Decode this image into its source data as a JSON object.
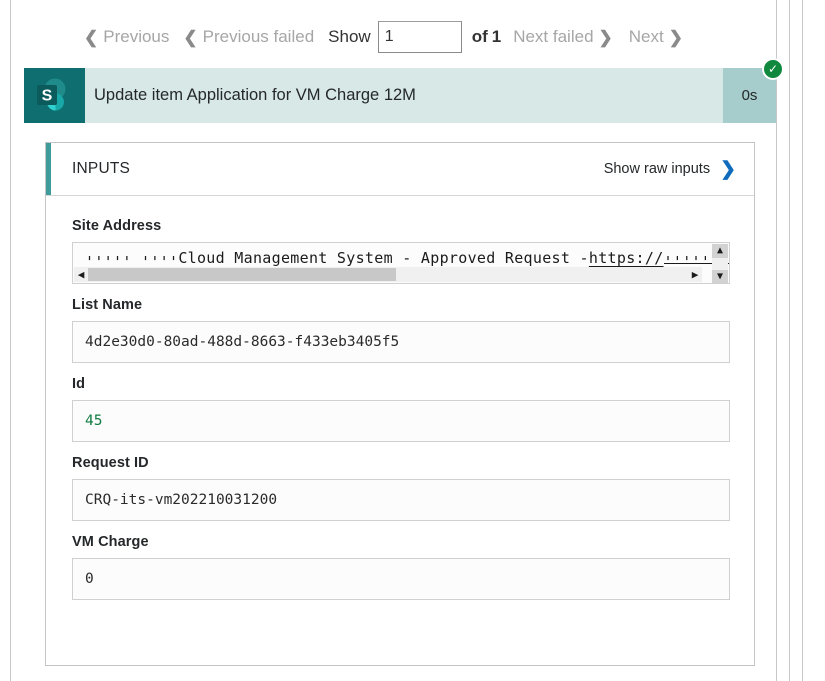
{
  "nav": {
    "previous_label": "Previous",
    "previous_failed_label": "Previous failed",
    "show_label": "Show",
    "page_value": "1",
    "of_label": "of",
    "page_count": "1",
    "next_failed_label": "Next failed",
    "next_label": "Next",
    "chevron_left": "❮",
    "chevron_right": "❯"
  },
  "action": {
    "icon_name": "sharepoint-icon",
    "title": "Update item Application for VM Charge 12M",
    "duration": "0s",
    "status_glyph": "✓"
  },
  "inputs_card": {
    "title": "INPUTS",
    "show_raw_label": "Show raw inputs",
    "chevron": "❯",
    "accent_color": "#3f9c9a",
    "fields": [
      {
        "label": "Site Address",
        "value_head_redacted": "''''' ''''",
        "value_mid": " Cloud Management System - Approved Request - ",
        "value_link": "https://",
        "value_tail_redacted": "'''''''",
        "has_scrollbars": true
      },
      {
        "label": "List Name",
        "value": "4d2e30d0-80ad-488d-8663-f433eb3405f5",
        "value_color": "#2b2b2b"
      },
      {
        "label": "Id",
        "value": "45",
        "value_color": "#107c41"
      },
      {
        "label": "Request ID",
        "value": "CRQ-its-vm202210031200",
        "value_color": "#2b2b2b"
      },
      {
        "label": "VM Charge",
        "value": "0",
        "value_color": "#2b2b2b"
      }
    ]
  },
  "scrollbar": {
    "arrow_left": "◀",
    "arrow_right": "▶",
    "arrow_up": "▲",
    "arrow_down": "▼"
  }
}
